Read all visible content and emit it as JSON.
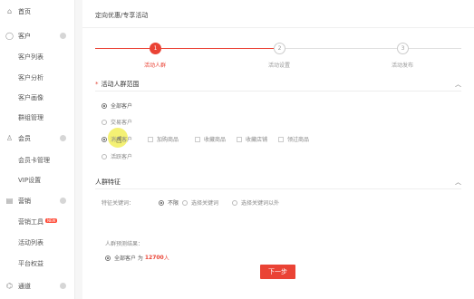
{
  "sidebar": {
    "groups": [
      {
        "label": "首页",
        "icon": "home-icon",
        "glyph": "⌂"
      },
      {
        "label": "客户",
        "icon": "user-icon",
        "glyph": "◯"
      },
      {
        "label": "会员",
        "icon": "member-icon",
        "glyph": "♙"
      },
      {
        "label": "营销",
        "icon": "marketing-icon",
        "glyph": "▤"
      },
      {
        "label": "通道",
        "icon": "channel-icon",
        "glyph": "⌬"
      }
    ],
    "items": [
      {
        "label": "客户列表"
      },
      {
        "label": "客户分析"
      },
      {
        "label": "客户画像"
      },
      {
        "label": "群组管理"
      },
      {
        "label": "会员卡管理"
      },
      {
        "label": "VIP设置"
      },
      {
        "label": "营销工具",
        "badge": "NEW"
      },
      {
        "label": "活动列表"
      },
      {
        "label": "平台权益"
      }
    ]
  },
  "breadcrumb": "定向优惠/专享活动",
  "steps": [
    {
      "num": "1",
      "label": "活动人群",
      "active": true
    },
    {
      "num": "2",
      "label": "活动设置",
      "active": false
    },
    {
      "num": "3",
      "label": "活动发布",
      "active": false
    }
  ],
  "scope": {
    "title": "活动人群范围",
    "required_mark": "*",
    "options": [
      {
        "label": "全部客户",
        "selected": true
      },
      {
        "label": "交易客户",
        "selected": false
      },
      {
        "label": "消费客户",
        "selected": false
      },
      {
        "label": "活跃客户",
        "selected": false
      }
    ],
    "sub_options": [
      "加购商品",
      "收藏商品",
      "收藏店铺",
      "领过商品"
    ]
  },
  "features": {
    "title": "人群特征",
    "field_label": "特征关键词：",
    "options": [
      {
        "label": "不限",
        "selected": true
      },
      {
        "label": "选择关键词",
        "selected": false
      },
      {
        "label": "选择关键词以外",
        "selected": false
      }
    ]
  },
  "result": {
    "title": "人群预测结果：",
    "prefix": "全部客户 为",
    "count": "12700",
    "suffix": "人"
  },
  "next_button": "下一步",
  "colors": {
    "accent": "#ea4335",
    "highlight": "#f2ee5c"
  }
}
